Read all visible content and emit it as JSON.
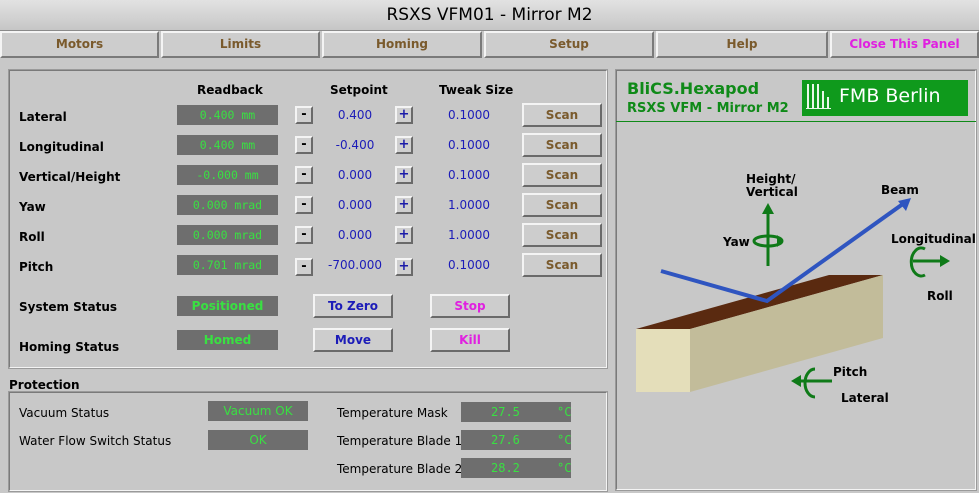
{
  "window": {
    "title": "RSXS VFM01 - Mirror M2"
  },
  "menu": {
    "items": [
      {
        "label": "Motors",
        "color": "#7a5a2c"
      },
      {
        "label": "Limits",
        "color": "#7a5a2c"
      },
      {
        "label": "Homing",
        "color": "#7a5a2c"
      },
      {
        "label": "Setup",
        "color": "#7a5a2c"
      },
      {
        "label": "Help",
        "color": "#7a5a2c"
      },
      {
        "label": "Close This Panel",
        "color": "#e020e0"
      }
    ]
  },
  "motion": {
    "headers": {
      "readback": "Readback",
      "setpoint": "Setpoint",
      "tweak": "Tweak Size"
    },
    "minus_label": "-",
    "plus_label": "+",
    "scan_label": "Scan",
    "axes": [
      {
        "label": "Lateral",
        "readback": "0.400 mm",
        "setpoint": "0.400",
        "tweak": "0.1000"
      },
      {
        "label": "Longitudinal",
        "readback": "0.400 mm",
        "setpoint": "-0.400",
        "tweak": "0.1000"
      },
      {
        "label": "Vertical/Height",
        "readback": "-0.000 mm",
        "setpoint": "0.000",
        "tweak": "0.1000"
      },
      {
        "label": "Yaw",
        "readback": "0.000 mrad",
        "setpoint": "0.000",
        "tweak": "1.0000"
      },
      {
        "label": "Roll",
        "readback": "0.000 mrad",
        "setpoint": "0.000",
        "tweak": "1.0000"
      },
      {
        "label": "Pitch",
        "readback": "0.701 mrad",
        "setpoint": "-700.000",
        "tweak": "0.1000"
      }
    ],
    "system_status": {
      "label": "System Status",
      "value": "Positioned"
    },
    "homing_status": {
      "label": "Homing Status",
      "value": "Homed"
    },
    "buttons": {
      "to_zero": "To Zero",
      "stop": "Stop",
      "move": "Move",
      "kill": "Kill"
    }
  },
  "protection": {
    "title": "Protection",
    "vacuum": {
      "label": "Vacuum Status",
      "value": "Vacuum OK"
    },
    "water": {
      "label": "Water Flow Switch Status",
      "value": "OK"
    },
    "temps": [
      {
        "label": "Temperature Mask",
        "value": "27.5",
        "unit": "°C"
      },
      {
        "label": "Temperature Blade 1",
        "value": "27.6",
        "unit": "°C"
      },
      {
        "label": "Temperature Blade 2",
        "value": "28.2",
        "unit": "°C"
      }
    ]
  },
  "diagram": {
    "brand_title": "BliCS.Hexapod",
    "subtitle": "RSXS VFM - Mirror M2",
    "logo_text": "FMB Berlin",
    "labels": {
      "height": "Height/",
      "vertical": "Vertical",
      "beam": "Beam",
      "yaw": "Yaw",
      "longitudinal": "Longitudinal",
      "roll": "Roll",
      "pitch": "Pitch",
      "lateral": "Lateral"
    }
  }
}
